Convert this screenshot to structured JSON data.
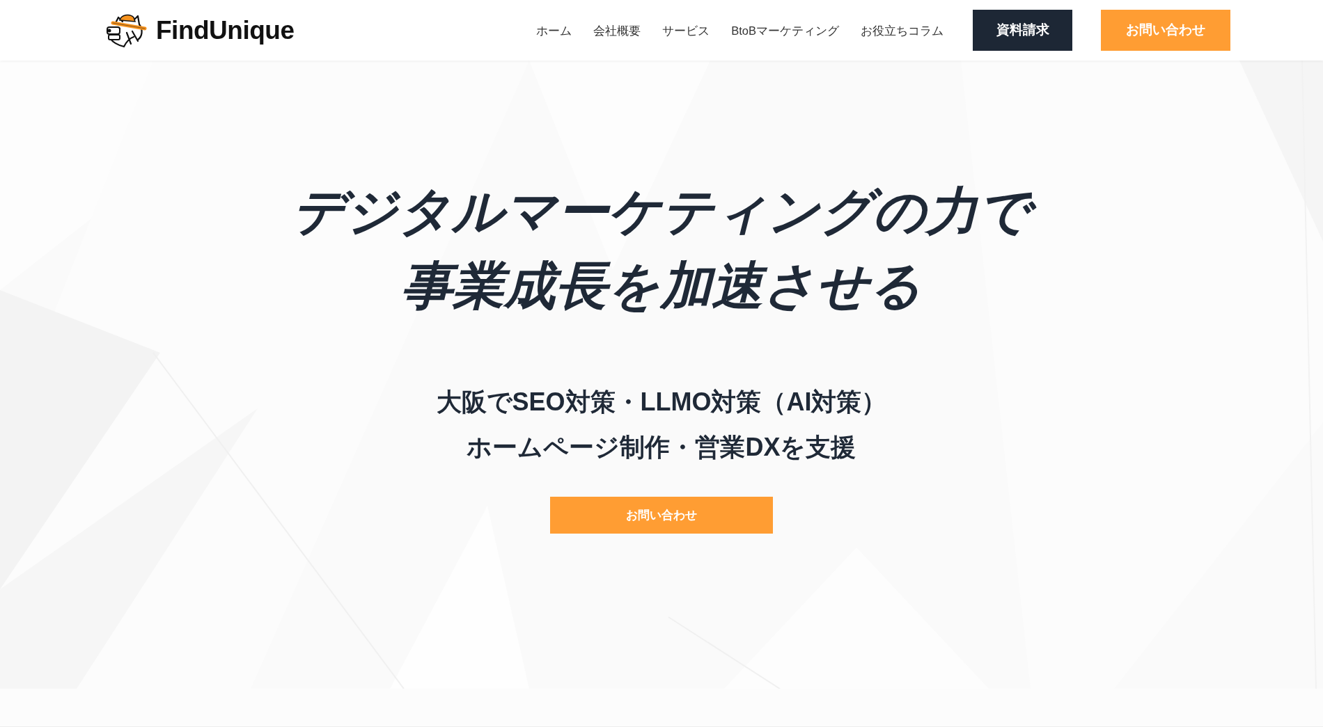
{
  "header": {
    "logo": {
      "text": "FindUnique"
    },
    "nav": [
      {
        "label": "ホーム"
      },
      {
        "label": "会社概要"
      },
      {
        "label": "サービス"
      },
      {
        "label": "BtoBマーケティング"
      },
      {
        "label": "お役立ちコラム"
      }
    ],
    "buttons": [
      {
        "label": "資料請求",
        "kind": "dark"
      },
      {
        "label": "お問い合わせ",
        "kind": "accent"
      }
    ]
  },
  "hero": {
    "headline": [
      "デジタルマーケティングの力で",
      "事業成長を加速させる"
    ],
    "subheadline": [
      "大阪でSEO対策・LLMO対策（AI対策）",
      "ホームページ制作・営業DXを支援"
    ],
    "cta": {
      "label": "お問い合わせ"
    }
  }
}
